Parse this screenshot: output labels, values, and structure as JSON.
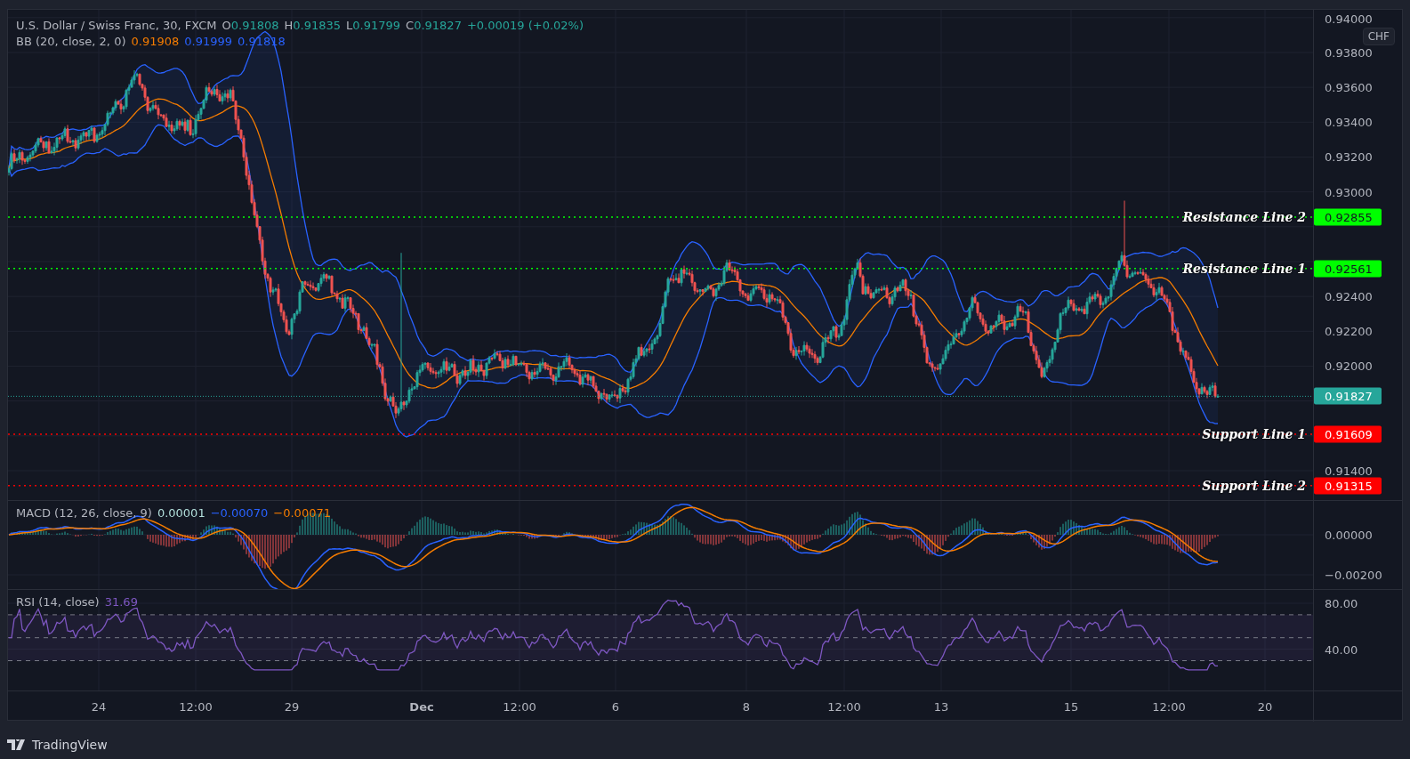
{
  "legend": {
    "symbol": "U.S. Dollar / Swiss Franc, 30, FXCM",
    "ohlc": [
      {
        "key": "O",
        "value": "0.91808"
      },
      {
        "key": "H",
        "value": "0.91835"
      },
      {
        "key": "L",
        "value": "0.91799"
      },
      {
        "key": "C",
        "value": "0.91827"
      }
    ],
    "change": "+0.00019 (+0.02%)"
  },
  "bollinger": {
    "name": "BB (20, close, 2, 0)",
    "values": [
      {
        "value": "0.91908",
        "color": "#f57c00"
      },
      {
        "value": "0.91999",
        "color": "#2962ff"
      },
      {
        "value": "0.91818",
        "color": "#2962ff"
      }
    ]
  },
  "price_axis": {
    "currency": "CHF",
    "ticks": [
      "0.94000",
      "0.93800",
      "0.93600",
      "0.93400",
      "0.93200",
      "0.93000",
      "0.92400",
      "0.92200",
      "0.92000",
      "0.91400"
    ]
  },
  "levels": [
    {
      "kind": "resistance",
      "label": "Resistance Line 2",
      "value": "0.92855",
      "color": "#00ff00"
    },
    {
      "kind": "resistance",
      "label": "Resistance Line 1",
      "value": "0.92561",
      "color": "#00ff00"
    },
    {
      "kind": "support",
      "label": "Support Line 1",
      "value": "0.91609",
      "color": "#ff0000"
    },
    {
      "kind": "support",
      "label": "Support Line 2",
      "value": "0.91315",
      "color": "#ff0000"
    }
  ],
  "last_price": {
    "value": "0.91827"
  },
  "macd": {
    "name": "MACD (12, 26, close, 9)",
    "values": [
      {
        "value": "0.00001",
        "color": "#b2dfdb"
      },
      {
        "value": "−0.00070",
        "color": "#2962ff"
      },
      {
        "value": "−0.00071",
        "color": "#f57c00"
      }
    ],
    "ticks": [
      "0.00000",
      "−0.00200"
    ]
  },
  "rsi": {
    "name": "RSI (14, close)",
    "values": [
      {
        "value": "31.69",
        "color": "#7e57c2"
      }
    ],
    "ticks": [
      "80.00",
      "40.00"
    ]
  },
  "time_axis": [
    {
      "label": "24",
      "bold": false
    },
    {
      "label": "12:00",
      "bold": false
    },
    {
      "label": "29",
      "bold": false
    },
    {
      "label": "Dec",
      "bold": true
    },
    {
      "label": "12:00",
      "bold": false
    },
    {
      "label": "6",
      "bold": false
    },
    {
      "label": "8",
      "bold": false
    },
    {
      "label": "12:00",
      "bold": false
    },
    {
      "label": "13",
      "bold": false
    },
    {
      "label": "15",
      "bold": false
    },
    {
      "label": "12:00",
      "bold": false
    },
    {
      "label": "20",
      "bold": false
    }
  ],
  "footer": {
    "brand": "TradingView"
  }
}
